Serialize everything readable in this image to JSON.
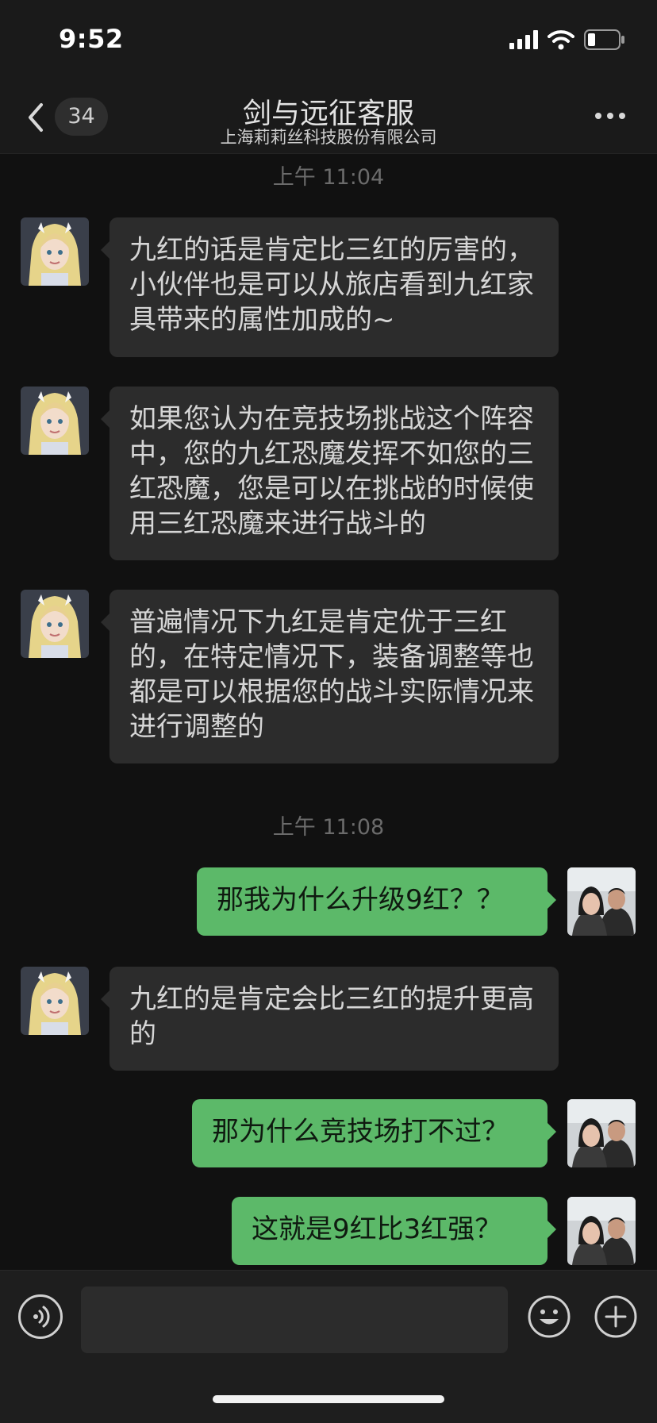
{
  "status_bar": {
    "time": "9:52"
  },
  "nav": {
    "unread_count": "34",
    "title": "剑与远征客服",
    "subtitle": "上海莉莉丝科技股份有限公司"
  },
  "messages": [
    {
      "type": "timestamp",
      "text": "上午 11:04"
    },
    {
      "type": "incoming",
      "text": "九红的话是肯定比三红的厉害的，小伙伴也是可以从旅店看到九红家具带来的属性加成的~"
    },
    {
      "type": "incoming",
      "text": "如果您认为在竞技场挑战这个阵容中，您的九红恐魔发挥不如您的三红恐魔，您是可以在挑战的时候使用三红恐魔来进行战斗的"
    },
    {
      "type": "incoming",
      "text": "普遍情况下九红是肯定优于三红的，在特定情况下，装备调整等也都是可以根据您的战斗实际情况来进行调整的"
    },
    {
      "type": "timestamp",
      "text": "上午 11:08"
    },
    {
      "type": "outgoing",
      "text": "那我为什么升级9红？？"
    },
    {
      "type": "incoming",
      "text": "九红的是肯定会比三红的提升更高的"
    },
    {
      "type": "outgoing",
      "text": "那为什么竞技场打不过？"
    },
    {
      "type": "outgoing",
      "text": "这就是9红比3红强？"
    }
  ],
  "input": {
    "placeholder": ""
  },
  "colors": {
    "background": "#111111",
    "incoming_bubble": "#2c2c2c",
    "outgoing_bubble": "#5cb969"
  },
  "icons": {
    "back": "chevron-left-icon",
    "more": "more-dots-icon",
    "voice": "voice-icon",
    "emoji": "emoji-icon",
    "plus": "plus-icon"
  }
}
